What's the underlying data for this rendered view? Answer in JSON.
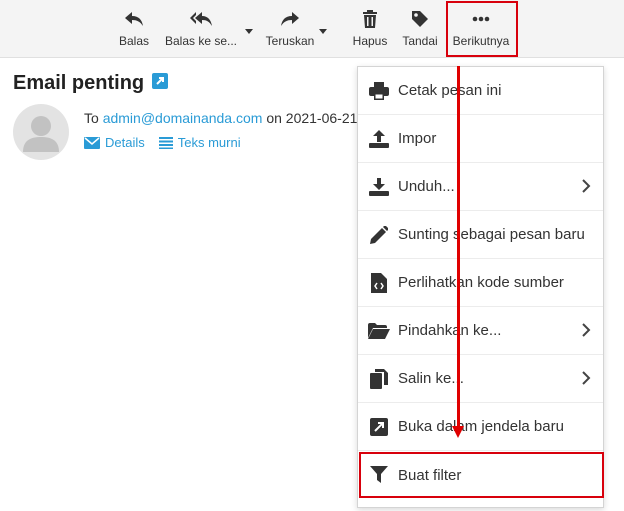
{
  "toolbar": {
    "reply": "Balas",
    "reply_all": "Balas ke se...",
    "forward": "Teruskan",
    "delete": "Hapus",
    "mark": "Tandai",
    "more": "Berikutnya"
  },
  "message": {
    "subject": "Email penting",
    "to_prefix": "To",
    "to_email": "admin@domainanda.com",
    "date_text": "on 2021-06-21",
    "details_label": "Details",
    "plain_label": "Teks murni"
  },
  "menu": {
    "items": [
      {
        "label": "Cetak pesan ini"
      },
      {
        "label": "Impor"
      },
      {
        "label": "Unduh..."
      },
      {
        "label": "Sunting sebagai pesan baru"
      },
      {
        "label": "Perlihatkan kode sumber"
      },
      {
        "label": "Pindahkan ke..."
      },
      {
        "label": "Salin ke..."
      },
      {
        "label": "Buka dalam jendela baru"
      },
      {
        "label": "Buat filter"
      }
    ]
  },
  "colors": {
    "link": "#2a9bd6",
    "highlight": "#d8000c",
    "icon": "#333333"
  }
}
